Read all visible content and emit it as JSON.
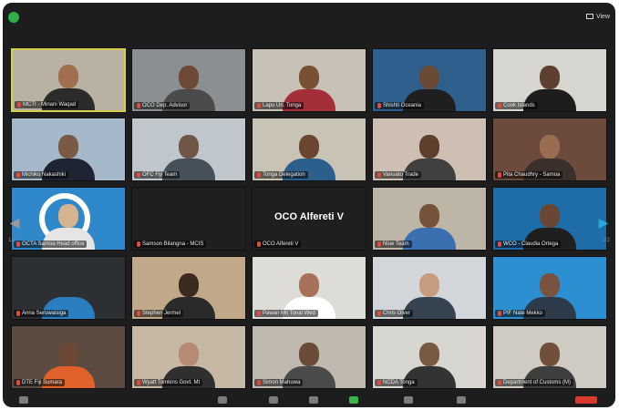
{
  "top_bar": {
    "view_label": "View"
  },
  "colors": {
    "active_speaker_border": "#d5ce4e",
    "security_green": "#2fae4a",
    "muted_red": "#e14a3c",
    "accent_blue": "#2aa6de"
  },
  "pagination": {
    "left": "1/2",
    "right": "1/2"
  },
  "tiles": [
    {
      "name": "MCTI - Minani Waqad",
      "active": true,
      "bg": "#b9b2a3",
      "head": "#a26f4e",
      "shirt": "#2b2b2b"
    },
    {
      "name": "OCO Dep. Advisor",
      "active": false,
      "bg": "#8b8f92",
      "head": "#6d4a35",
      "shirt": "#4b4b4b"
    },
    {
      "name": "Lapu Un. Tonga",
      "active": false,
      "bg": "#c7c1b6",
      "head": "#7a5034",
      "shirt": "#a32f3b"
    },
    {
      "name": "Shishti Oceania",
      "active": false,
      "bg": "#2e5f8d",
      "head": "#6a4a35",
      "shirt": "#1f1f1f"
    },
    {
      "name": "Cook Islands",
      "active": false,
      "bg": "#d7d5cf",
      "head": "#5d4031",
      "shirt": "#1d1d1d"
    },
    {
      "name": "Michiko Nakashiki",
      "active": false,
      "bg": "#a5b8c9",
      "head": "#7b5a45",
      "shirt": "#1e2433"
    },
    {
      "name": "OFC Fiji Team",
      "active": false,
      "bg": "#bfc6cc",
      "head": "#6f5646",
      "shirt": "#46505a"
    },
    {
      "name": "Tonga Delegation",
      "active": false,
      "bg": "#c9c3b5",
      "head": "#6a4631",
      "shirt": "#2c5f8c"
    },
    {
      "name": "Vanuatu Trade",
      "active": false,
      "bg": "#cdbfb1",
      "head": "#5e3e2c",
      "shirt": "#404040"
    },
    {
      "name": "Pita Chaudhry - Samoa",
      "active": false,
      "bg": "#6c4b3c",
      "head": "#9a6d52",
      "shirt": "#3a2f2a"
    },
    {
      "name": "OCTA Samoa Head office",
      "active": false,
      "bg": "#2e88c9",
      "head": "#d8b38f",
      "shirt": "#e5e5e5",
      "logo": true
    },
    {
      "name": "Samson Bilangna - MCIS",
      "active": false,
      "textonly": true,
      "bg": "#1f1f1f",
      "head": "#1f1f1f",
      "shirt": "#1f1f1f"
    },
    {
      "name": "OCO Alfereti V",
      "active": false,
      "textonly": true,
      "bg": "#1f1f1f",
      "head": "#1f1f1f",
      "shirt": "#1f1f1f",
      "big_name": "OCO Alfereti V"
    },
    {
      "name": "Niue Team",
      "active": false,
      "bg": "#bdb6a6",
      "head": "#77523b",
      "shirt": "#3a6fb0"
    },
    {
      "name": "WCO - Claudia Ortega",
      "active": false,
      "bg": "#1e6da9",
      "head": "#6a4734",
      "shirt": "#1f1f1f"
    },
    {
      "name": "Anna Seruwaisiga",
      "active": false,
      "bg": "#2c2f33",
      "head": "#2c2f33",
      "shirt": "#2b7fc0"
    },
    {
      "name": "Stephen Jermel",
      "active": false,
      "bg": "#c1a889",
      "head": "#3b2a20",
      "shirt": "#2a2a2a"
    },
    {
      "name": "Pawan Mit Tonal Wed",
      "active": false,
      "bg": "#dedcd7",
      "head": "#a7715a",
      "shirt": "#ffffff"
    },
    {
      "name": "Chris Olver",
      "active": false,
      "bg": "#d2d6da",
      "head": "#c69b7f",
      "shirt": "#364451"
    },
    {
      "name": "PIF Nate Mekko",
      "active": false,
      "bg": "#2b8fd1",
      "head": "#7a5340",
      "shirt": "#2d3a4a"
    },
    {
      "name": "DTE Fiji Sumara",
      "active": false,
      "bg": "#5a4a40",
      "head": "#6d4835",
      "shirt": "#e0622a"
    },
    {
      "name": "Wyatt Tomkins Govt. Mt",
      "active": false,
      "bg": "#c7b8a5",
      "head": "#b58c73",
      "shirt": "#2f2f2f"
    },
    {
      "name": "Simon Mahuwa",
      "active": false,
      "bg": "#bfb9b0",
      "head": "#6a4b38",
      "shirt": "#4a4a4a"
    },
    {
      "name": "NCDA Tonga",
      "active": false,
      "bg": "#d8d6d0",
      "head": "#7a5942",
      "shirt": "#333333"
    },
    {
      "name": "Department of Customs (M)",
      "active": false,
      "bg": "#cfcac2",
      "head": "#70503b",
      "shirt": "#3e3e3e"
    }
  ]
}
